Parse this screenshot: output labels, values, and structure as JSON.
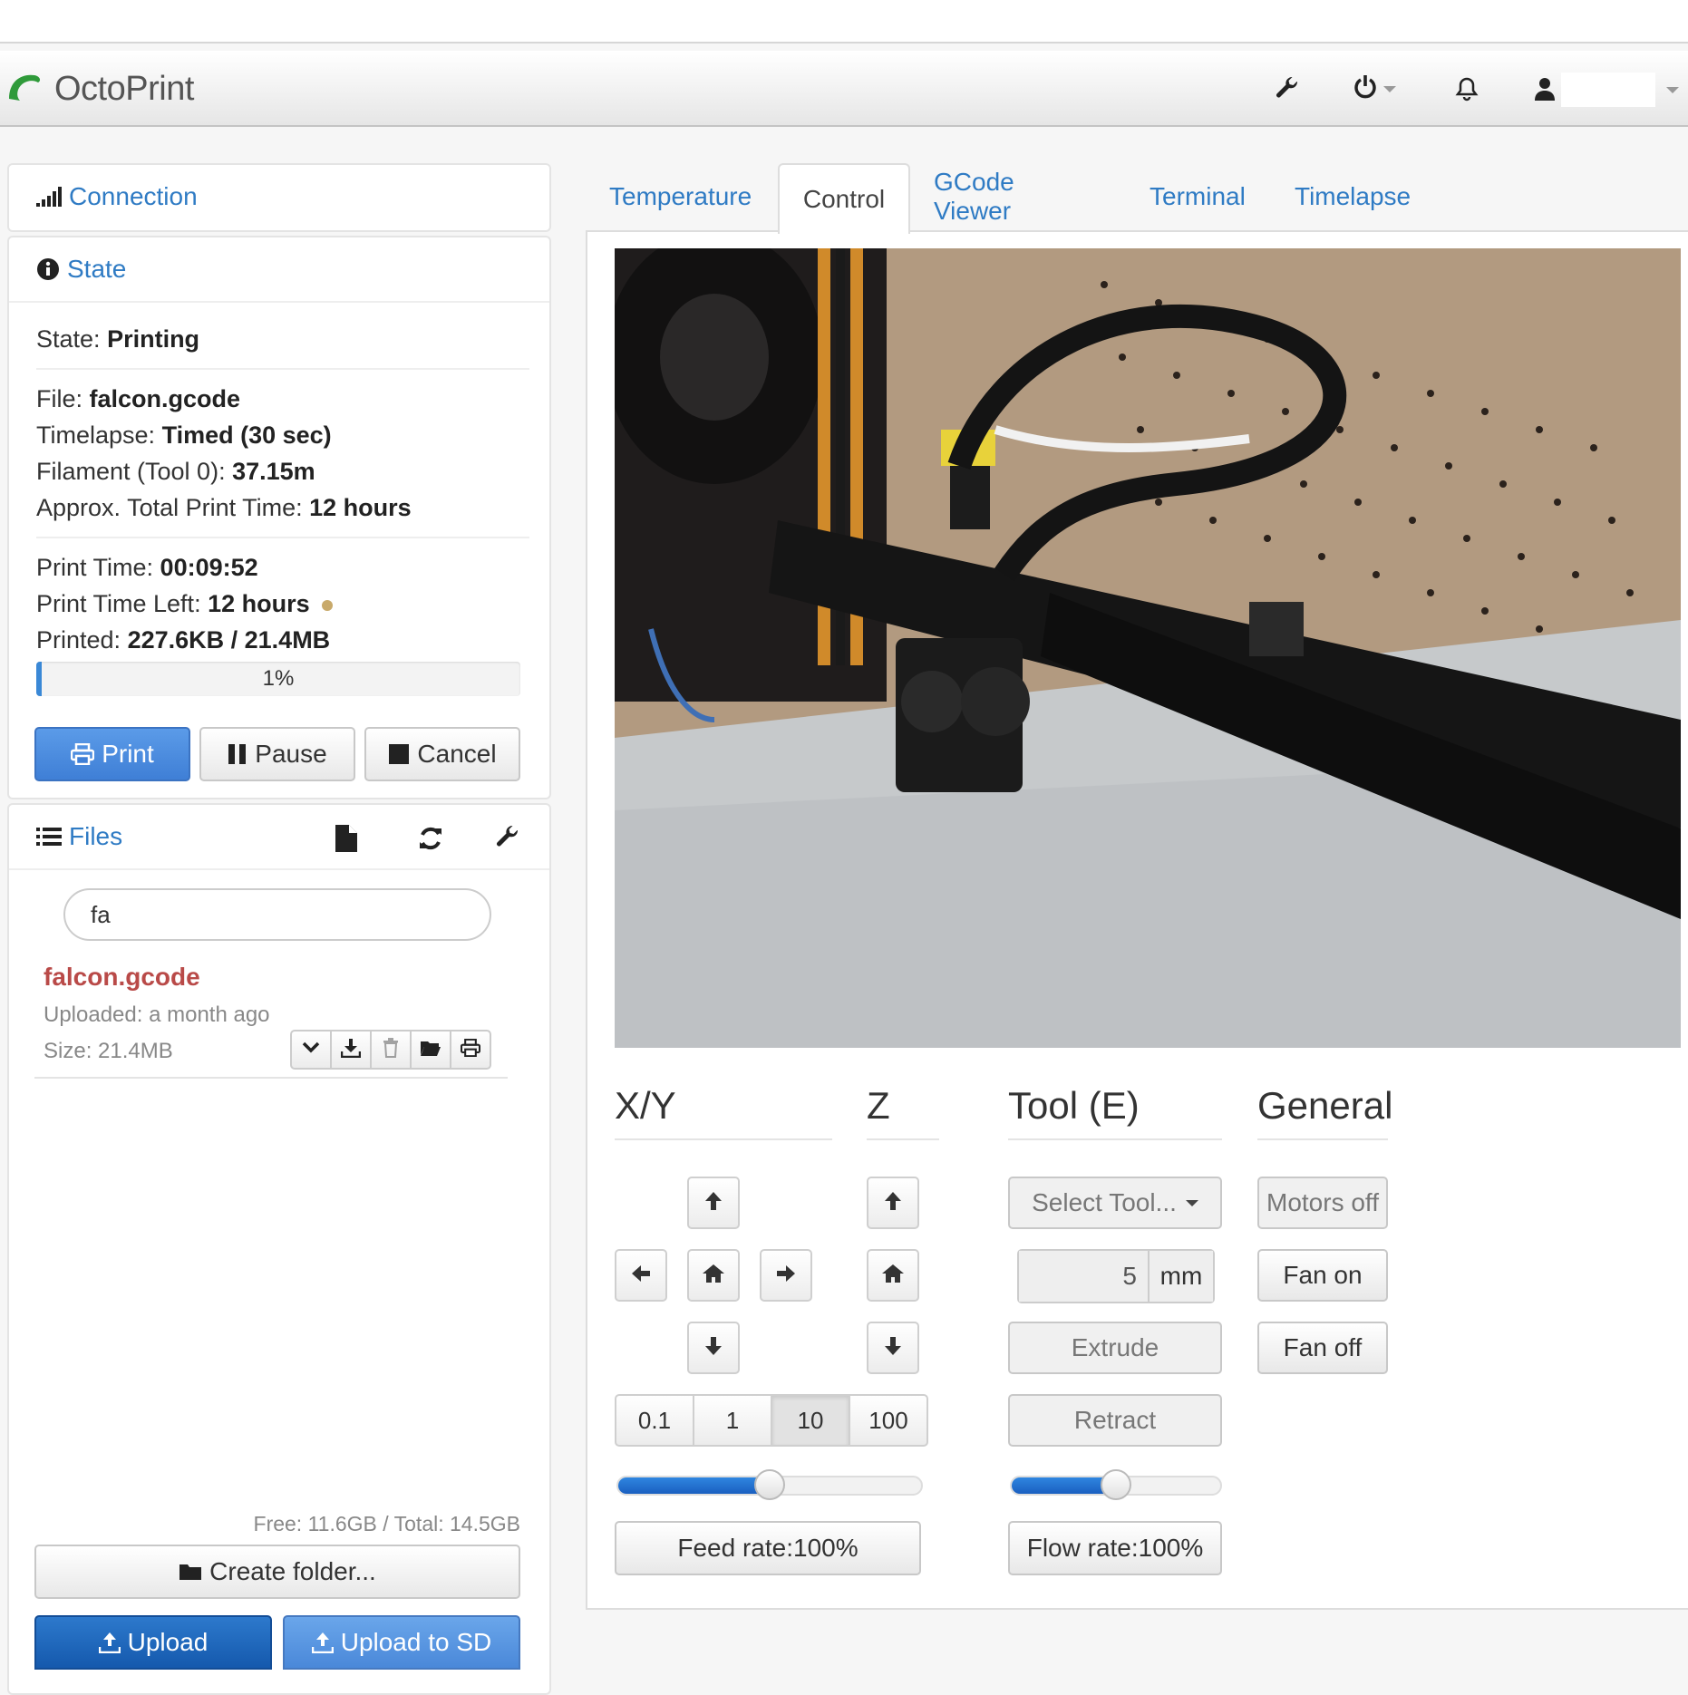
{
  "app": {
    "brand": "OctoPrint"
  },
  "sidebar": {
    "connection_title": "Connection",
    "state_title": "State",
    "state": {
      "state_label": "State:",
      "state_value": "Printing",
      "file_label": "File:",
      "file_value": "falcon.gcode",
      "timelapse_label": "Timelapse:",
      "timelapse_value": "Timed (30 sec)",
      "filament_label": "Filament (Tool 0):",
      "filament_value": "37.15m",
      "approx_label": "Approx. Total Print Time:",
      "approx_value": "12 hours",
      "printtime_label": "Print Time:",
      "printtime_value": "00:09:52",
      "timeleft_label": "Print Time Left:",
      "timeleft_value": "12 hours",
      "printed_label": "Printed:",
      "printed_value": "227.6KB / 21.4MB",
      "progress_text": "1%",
      "progress_fraction": 0.01
    },
    "buttons": {
      "print": "Print",
      "pause": "Pause",
      "cancel": "Cancel"
    },
    "files_title": "Files",
    "search_value": "fa",
    "file": {
      "name": "falcon.gcode",
      "uploaded": "Uploaded: a month ago",
      "size": "Size: 21.4MB"
    },
    "storage": "Free: 11.6GB / Total: 14.5GB",
    "create_folder": "Create folder...",
    "upload": "Upload",
    "upload_sd": "Upload to SD"
  },
  "tabs": [
    "Temperature",
    "Control",
    "GCode Viewer",
    "Terminal",
    "Timelapse"
  ],
  "control": {
    "sections": {
      "xy": "X/Y",
      "z": "Z",
      "tool": "Tool (E)",
      "general": "General"
    },
    "step_sizes": [
      "0.1",
      "1",
      "10",
      "100"
    ],
    "active_step": "10",
    "feed_rate_label": "Feed rate:100%",
    "feed_rate_fraction": 0.5,
    "tool_select": "Select Tool...",
    "extrude_amount": "5",
    "extrude_unit": "mm",
    "extrude": "Extrude",
    "retract": "Retract",
    "flow_rate_label": "Flow rate:100%",
    "flow_rate_fraction": 0.5,
    "motors_off": "Motors off",
    "fan_on": "Fan on",
    "fan_off": "Fan off"
  },
  "colors": {
    "link": "#2f7bc4",
    "primary": "#3f7fd6",
    "file_name": "#b94a48",
    "status_dot": "#c8a96a"
  }
}
